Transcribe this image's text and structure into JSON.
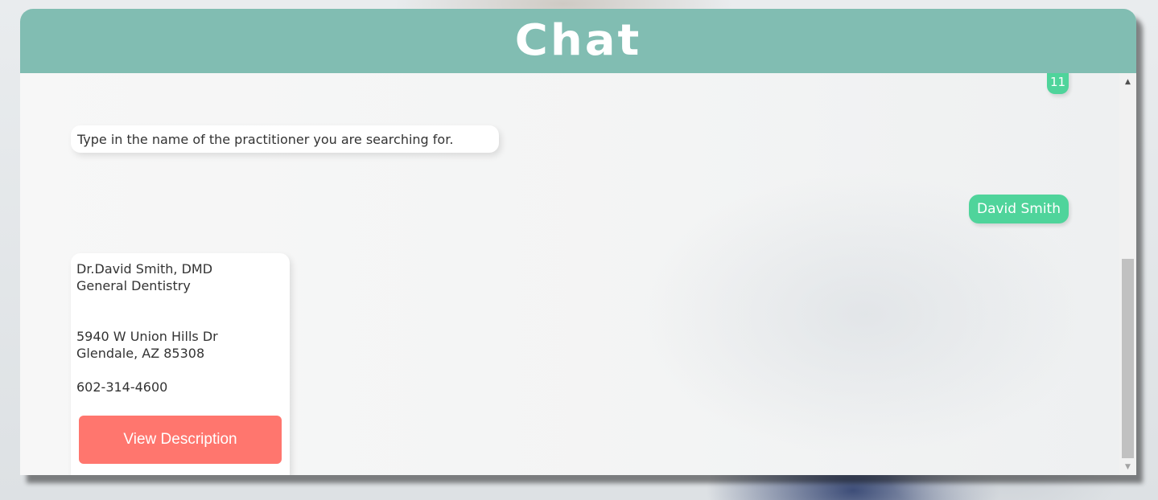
{
  "header": {
    "title": "Chat"
  },
  "messages": {
    "prev_user_partial": "11",
    "bot_prompt": "Type in the name of the practitioner you are searching for.",
    "user_reply": "David Smith"
  },
  "practitioner_card": {
    "name_line": "Dr.David Smith, DMD",
    "specialty": "General Dentistry",
    "address_line1": "5940 W Union Hills Dr",
    "address_line2": "Glendale, AZ 85308",
    "phone": "602-314-4600",
    "button_label": "View Description"
  },
  "scrollbar": {
    "up_glyph": "▲",
    "down_glyph": "▼"
  },
  "colors": {
    "header": "#81bdb2",
    "user_bubble": "#4fd49b",
    "button": "#ff766e"
  }
}
